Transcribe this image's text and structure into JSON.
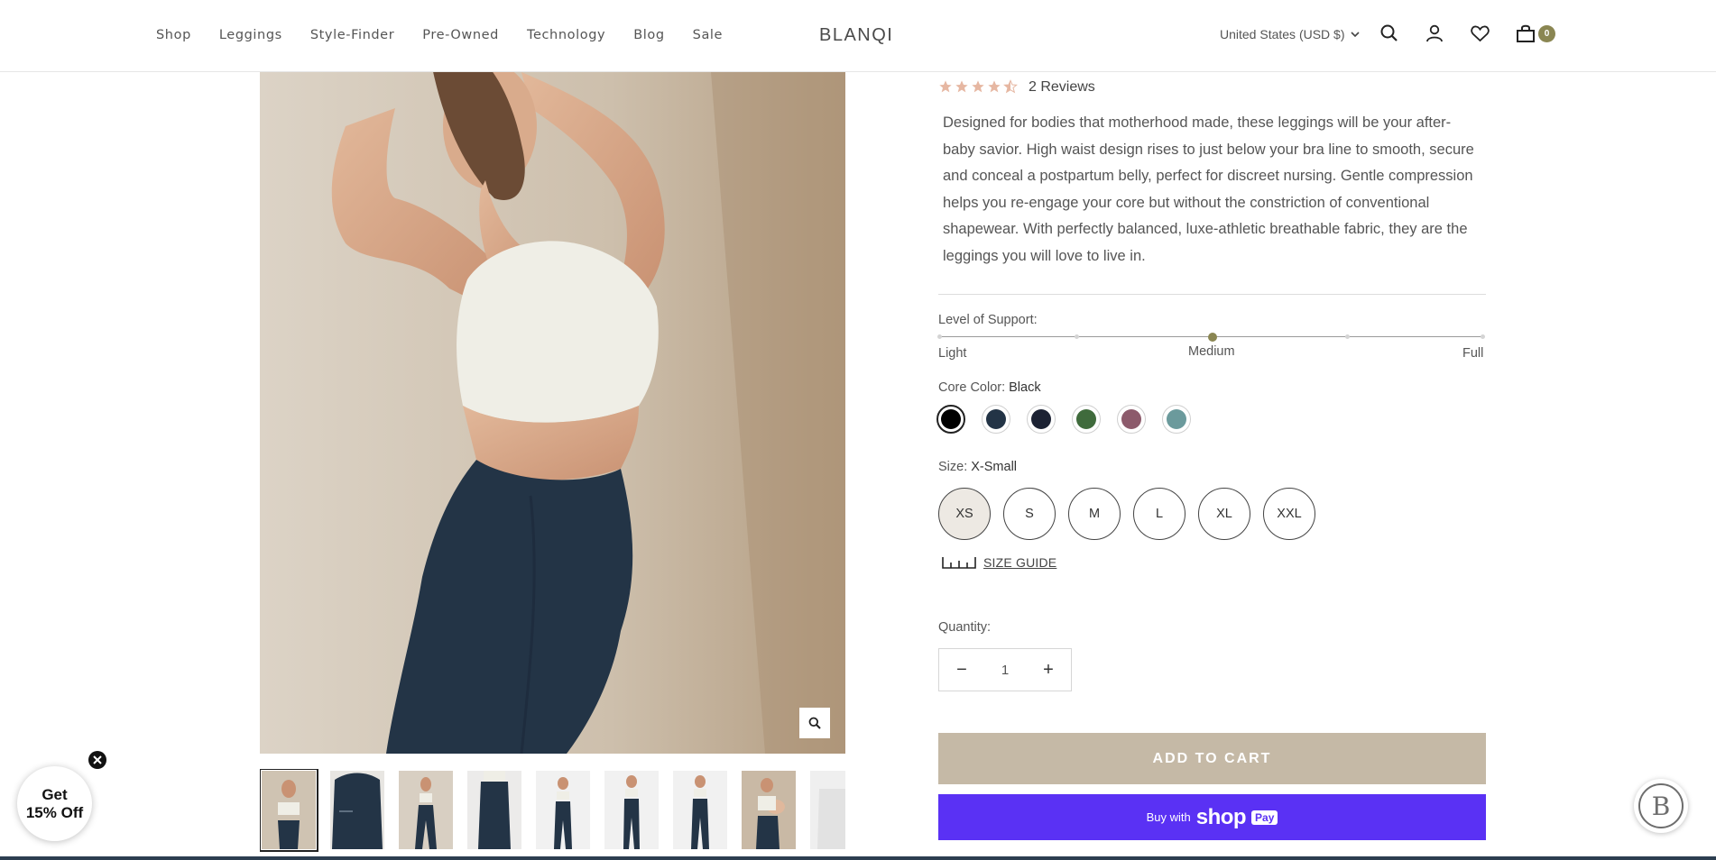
{
  "header": {
    "nav": [
      "Shop",
      "Leggings",
      "Style-Finder",
      "Pre-Owned",
      "Technology",
      "Blog",
      "Sale"
    ],
    "logo": "BLANQI",
    "currency": "United States (USD $)",
    "cart_count": "0",
    "icons": [
      "search-icon",
      "account-icon",
      "wishlist-heart-icon",
      "cart-bag-icon"
    ]
  },
  "product": {
    "rating": 4.5,
    "reviews": "2 Reviews",
    "description": "Designed for bodies that motherhood made, these leggings will be your after-baby savior. High waist design rises to just below your bra line to smooth, secure and conceal a postpartum belly, perfect for discreet nursing. Gentle compression helps you re-engage your core but without the constriction of conventional shapewear. With perfectly balanced, luxe-athletic breathable fabric, they are the leggings you will love to live in.",
    "support": {
      "label": "Level of Support:",
      "low": "Light",
      "mid": "Medium",
      "high": "Full",
      "level": 0.5
    },
    "color": {
      "label": "Core Color:",
      "value": "Black",
      "swatches": [
        "#000000",
        "#233446",
        "#1c2233",
        "#3f6b3c",
        "#8c5a6b",
        "#6b9a9c"
      ]
    },
    "size": {
      "label": "Size:",
      "value": "X-Small",
      "options": [
        "XS",
        "S",
        "M",
        "L",
        "XL",
        "XXL"
      ],
      "guide": "SIZE GUIDE"
    },
    "quantity": {
      "label": "Quantity:",
      "value": "1",
      "minus": "−",
      "plus": "+"
    },
    "add_to_cart": "ADD TO CART",
    "shop_pay": {
      "pre": "Buy with",
      "brand": "shop",
      "pay": "Pay"
    }
  },
  "gallery": {
    "thumb_count": 9,
    "active_thumb": 0
  },
  "promo": {
    "line1": "Get",
    "line2": "15% Off"
  },
  "colors": {
    "accent": "#8a8652",
    "add_to_cart_bg": "#c5b9a6",
    "shop_pay_bg": "#5a31f4",
    "leggings_navy": "#233446"
  }
}
